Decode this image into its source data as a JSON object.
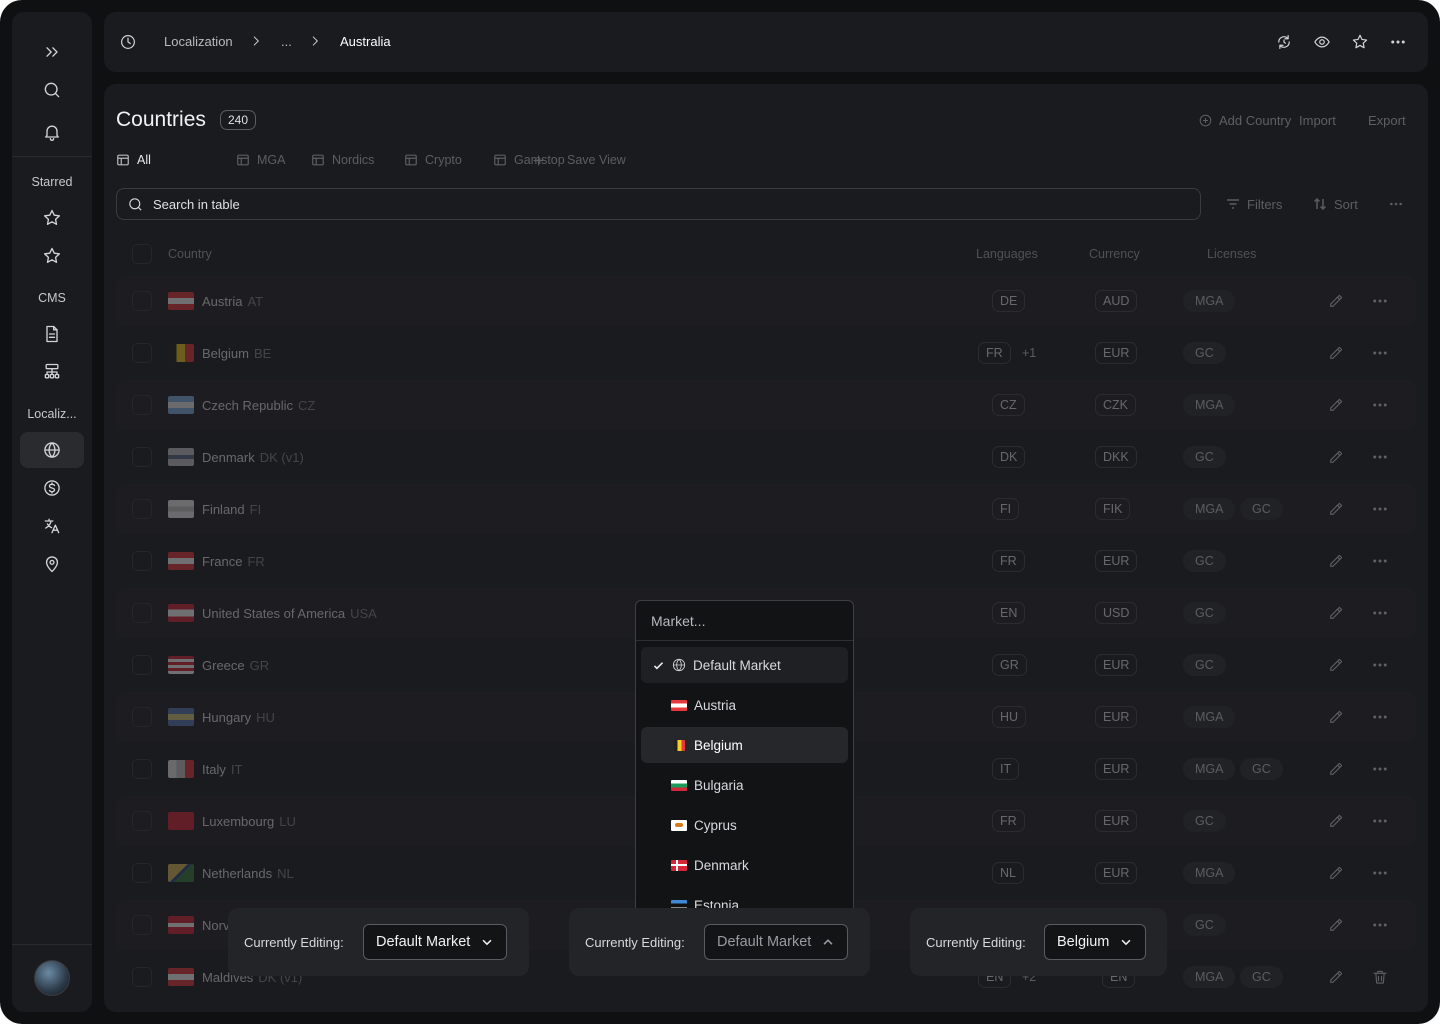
{
  "breadcrumb": {
    "root": "Localization",
    "ellipsis": "...",
    "current": "Australia"
  },
  "sidebar": {
    "section_starred": "Starred",
    "section_cms": "CMS",
    "section_localization": "Localiz..."
  },
  "header": {
    "title": "Countries",
    "count": "240",
    "actions": {
      "add": "Add Country",
      "import": "Import",
      "export": "Export"
    }
  },
  "tabs": [
    {
      "label": "All",
      "active": true
    },
    {
      "label": "MGA"
    },
    {
      "label": "Nordics"
    },
    {
      "label": "Crypto"
    },
    {
      "label": "Gamstop"
    },
    {
      "label": "Save View"
    }
  ],
  "search": {
    "placeholder": "Search in table"
  },
  "toolbar": {
    "filters": "Filters",
    "sort": "Sort"
  },
  "columns": {
    "country": "Country",
    "languages": "Languages",
    "currency": "Currency",
    "licenses": "Licenses"
  },
  "rows": [
    {
      "name": "Austria",
      "code": "AT",
      "languages": [
        "DE"
      ],
      "lang_more": "",
      "currency": "AUD",
      "licenses": [
        "MGA"
      ]
    },
    {
      "name": "Belgium",
      "code": "BE",
      "languages": [
        "FR"
      ],
      "lang_more": "+1",
      "currency": "EUR",
      "licenses": [
        "GC"
      ]
    },
    {
      "name": "Czech Republic",
      "code": "CZ",
      "languages": [
        "CZ"
      ],
      "lang_more": "",
      "currency": "CZK",
      "licenses": [
        "MGA"
      ]
    },
    {
      "name": "Denmark",
      "code": "DK (v1)",
      "languages": [
        "DK"
      ],
      "lang_more": "",
      "currency": "DKK",
      "licenses": [
        "GC"
      ]
    },
    {
      "name": "Finland",
      "code": "FI",
      "languages": [
        "FI"
      ],
      "lang_more": "",
      "currency": "FIK",
      "licenses": [
        "MGA",
        "GC"
      ]
    },
    {
      "name": "France",
      "code": "FR",
      "languages": [
        "FR"
      ],
      "lang_more": "",
      "currency": "EUR",
      "licenses": [
        "GC"
      ]
    },
    {
      "name": "United States of America",
      "code": "USA",
      "languages": [
        "EN"
      ],
      "lang_more": "",
      "currency": "USD",
      "licenses": [
        "GC"
      ]
    },
    {
      "name": "Greece",
      "code": "GR",
      "languages": [
        "GR"
      ],
      "lang_more": "",
      "currency": "EUR",
      "licenses": [
        "GC"
      ]
    },
    {
      "name": "Hungary",
      "code": "HU",
      "languages": [
        "HU"
      ],
      "lang_more": "",
      "currency": "EUR",
      "licenses": [
        "MGA"
      ]
    },
    {
      "name": "Italy",
      "code": "IT",
      "languages": [
        "IT"
      ],
      "lang_more": "",
      "currency": "EUR",
      "licenses": [
        "MGA",
        "GC"
      ]
    },
    {
      "name": "Luxembourg",
      "code": "LU",
      "languages": [
        "FR"
      ],
      "lang_more": "",
      "currency": "EUR",
      "licenses": [
        "GC"
      ]
    },
    {
      "name": "Netherlands",
      "code": "NL",
      "languages": [
        "NL"
      ],
      "lang_more": "",
      "currency": "EUR",
      "licenses": [
        "MGA"
      ]
    },
    {
      "name": "Norv",
      "code": "",
      "languages": [],
      "lang_more": "",
      "currency": "",
      "licenses": [
        "GC"
      ]
    },
    {
      "name": "Maldives",
      "code": "DK (v1)",
      "languages": [
        "EN"
      ],
      "lang_more": "+2",
      "currency": "EN",
      "licenses": [
        "MGA",
        "GC"
      ]
    }
  ],
  "dropdown": {
    "placeholder": "Market...",
    "items": [
      "Default Market",
      "Austria",
      "Belgium",
      "Bulgaria",
      "Cyprus",
      "Denmark",
      "Estonia"
    ]
  },
  "editing": {
    "label": "Currently Editing:",
    "first": "Default Market",
    "second": "Default Market",
    "third": "Belgium"
  }
}
